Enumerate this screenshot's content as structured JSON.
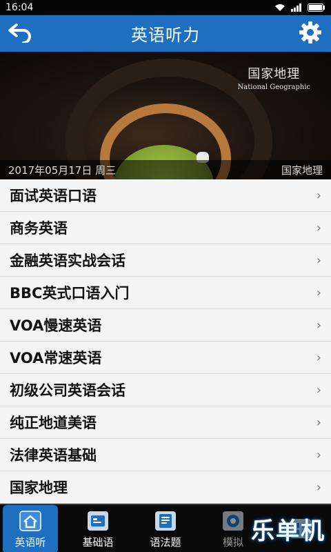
{
  "status_bar": {
    "time": "16:04"
  },
  "header": {
    "title": "英语听力"
  },
  "banner": {
    "logo_cn": "国家地理",
    "logo_en": "National Geographic",
    "date": "2017年05月17日 周三",
    "category": "国家地理"
  },
  "list": {
    "items": [
      {
        "label": "面试英语口语"
      },
      {
        "label": "商务英语"
      },
      {
        "label": "金融英语实战会话"
      },
      {
        "label": "BBC英式口语入门"
      },
      {
        "label": "VOA慢速英语"
      },
      {
        "label": "VOA常速英语"
      },
      {
        "label": "初级公司英语会话"
      },
      {
        "label": "纯正地道美语"
      },
      {
        "label": "法律英语基础"
      },
      {
        "label": "国家地理"
      }
    ],
    "chevron": "›"
  },
  "tabs": [
    {
      "label": "英语听",
      "icon": "house-icon"
    },
    {
      "label": "基础语",
      "icon": "card-icon"
    },
    {
      "label": "语法题",
      "icon": "doc-icon"
    },
    {
      "label": "模拟",
      "icon": "target-icon"
    },
    {
      "label": "",
      "icon": "grid-icon"
    }
  ],
  "watermark": "乐单机",
  "colors": {
    "accent": "#1f6fc0",
    "list_bg": "#f4f4f4",
    "divider": "#d6d6d6"
  }
}
